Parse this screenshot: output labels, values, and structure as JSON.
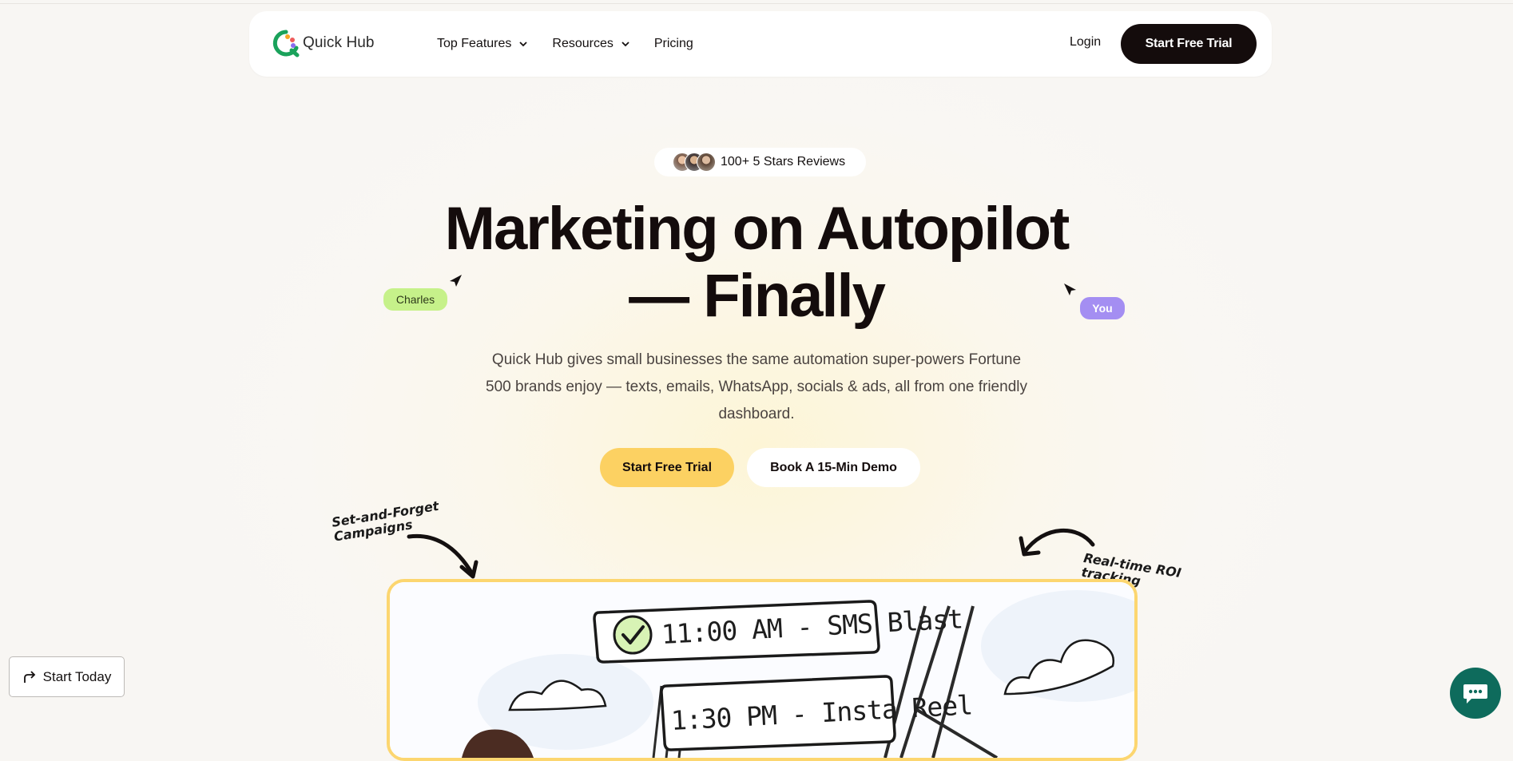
{
  "nav": {
    "brand": "Quick Hub",
    "links": [
      {
        "label": "Top Features",
        "has_dropdown": true
      },
      {
        "label": "Resources",
        "has_dropdown": true
      },
      {
        "label": "Pricing",
        "has_dropdown": false
      }
    ],
    "login": "Login",
    "cta": "Start Free Trial"
  },
  "hero": {
    "reviews": "100+  5 Stars Reviews",
    "headline_line1": "Marketing on Autopilot",
    "headline_line2": "— Finally",
    "subtext": "Quick Hub gives small businesses the same automation super-powers Fortune 500 brands enjoy — texts, emails, WhatsApp, socials & ads, all from one friendly dashboard.",
    "primary_cta": "Start Free Trial",
    "secondary_cta": "Book A 15-Min Demo",
    "cursor_tags": {
      "left": "Charles",
      "right": "You"
    }
  },
  "annotations": {
    "left": "Set-and-Forget\nCampaigns",
    "right": "Real-time ROI\ntracking"
  },
  "preview": {
    "item1": "11:00 AM - SMS Blast",
    "item2": "1:30 PM - Insta Reel"
  },
  "floating": {
    "start_today": "Start Today"
  },
  "colors": {
    "brand_dark": "#140c0c",
    "accent_yellow": "#fcd162",
    "tag_green": "#c6f18a",
    "tag_purple": "#a48ef2",
    "chat_teal": "#0e6b5c",
    "logo_green": "#1aa25b"
  },
  "icons": [
    "quick-hub-logo-icon",
    "chevron-down-icon",
    "cursor-arrow-icon",
    "hand-drawn-arrow-icon",
    "check-circle-icon",
    "share-arrow-icon",
    "chat-bubble-icon"
  ]
}
